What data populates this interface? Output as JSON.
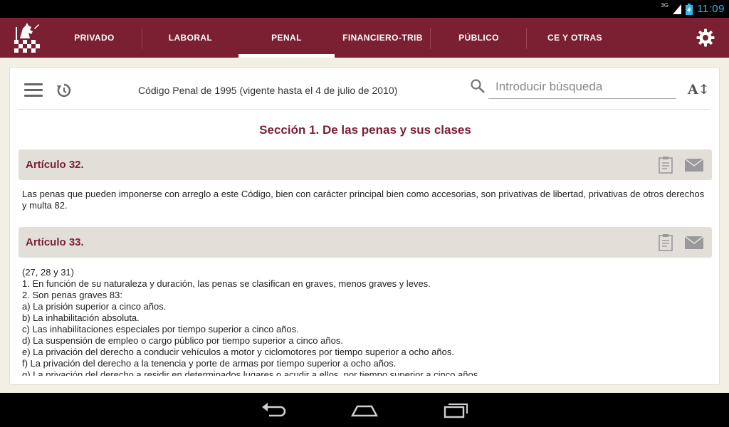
{
  "status": {
    "network": "3G",
    "time": "11:09"
  },
  "appbar": {
    "tabs": [
      {
        "label": "PRIVADO"
      },
      {
        "label": "LABORAL"
      },
      {
        "label": "PENAL"
      },
      {
        "label": "FINANCIERO-TRIB"
      },
      {
        "label": "PÚBLICO"
      },
      {
        "label": "CE Y OTRAS"
      }
    ],
    "active_tab": "PENAL",
    "accent": "#7b1f32"
  },
  "toolbar": {
    "document_title": "Código Penal de 1995 (vigente hasta el 4 de julio de 2010)",
    "search_placeholder": "Introducir búsqueda",
    "font_size_button": "A↕"
  },
  "section": {
    "title": "Sección 1. De las penas y sus clases"
  },
  "articles": [
    {
      "title": "Artículo 32.",
      "lines": [
        "Las penas que pueden imponerse con arreglo a este Código, bien con carácter principal bien como accesorias, son privativas de libertad, privativas de otros derechos y multa 82."
      ]
    },
    {
      "title": "Artículo 33.",
      "lines": [
        "(27, 28 y 31)",
        "1. En función de su naturaleza y duración, las penas se clasifican en graves, menos graves y leves.",
        "2. Son penas graves 83:",
        "a) La prisión superior a cinco años.",
        "b) La inhabilitación absoluta.",
        "c) Las inhabilitaciones especiales por tiempo superior a cinco años.",
        "d) La suspensión de empleo o cargo público por tiempo superior a cinco años.",
        "e) La privación del derecho a conducir vehículos a motor y ciclomotores por tiempo superior a ocho años.",
        "f) La privación del derecho a la tenencia y porte de armas por tiempo superior a ocho años.",
        "g) La privación del derecho a residir en determinados lugares o acudir a ellos, por tiempo superior a cinco años."
      ]
    }
  ]
}
